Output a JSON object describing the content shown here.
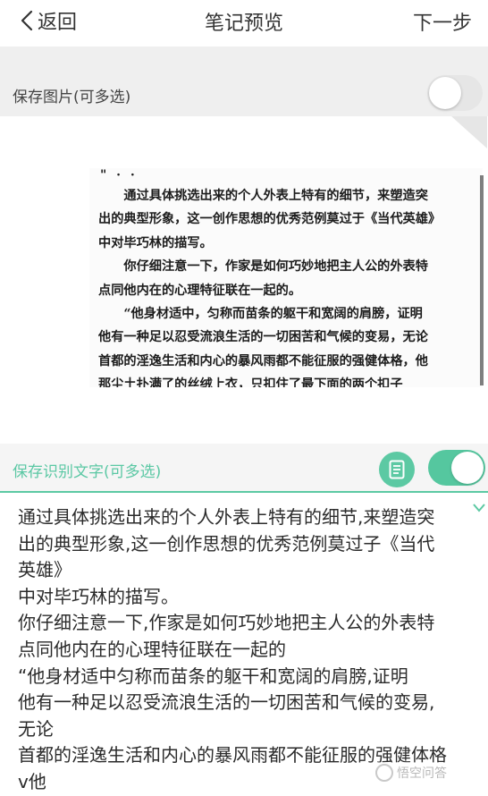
{
  "nav": {
    "back_label": "返回",
    "title": "笔记预览",
    "next_label": "下一步"
  },
  "save_image": {
    "label": "保存图片(可多选)",
    "enabled": false
  },
  "scan": {
    "top_marks": "\" · ·",
    "lines": [
      "　　通过具体挑选出来的个人外表上特有的细节，来塑造突",
      "出的典型形象，这一创作思想的优秀范例莫过于《当代英雄》",
      "中对毕巧林的描写。",
      "　　你仔细注意一下，作家是如何巧妙地把主人公的外表特",
      "点同他内在的心理特征联在一起的。",
      "　　“他身材适中，匀称而苗条的躯干和宽阔的肩膀，证明",
      "他有一种足以忍受流浪生活的一切困苦和气候的变易，无论",
      "首都的淫逸生活和内心的暴风雨都不能征服的强健体格，他",
      "那尘土扑满了的丝绒上衣，只扣住了最下面的两个扣子"
    ]
  },
  "save_text": {
    "label": "保存识别文字(可多选)",
    "enabled": true,
    "doc_icon": "document-icon"
  },
  "ocr": {
    "lines": [
      "通过具体挑选出来的个人外表上特有的细节,来塑造突",
      "出的典型形象,这一创作思想的优秀范例莫过子《当代",
      "英雄》",
      "中对毕巧林的描写。",
      "你仔细注意一下,作家是如何巧妙地把主人公的外表特",
      "点同他内在的心理特征联在一起的",
      "“他身材适中匀称而苗条的躯干和宽阔的肩膀,证明",
      "他有一种足以忍受流浪生活的一切困苦和气候的变易,",
      "无论",
      "首都的淫逸生活和内心的暴风雨都不能征服的强健体格",
      "v他"
    ]
  },
  "watermark": {
    "text": "悟空问答"
  },
  "colors": {
    "accent": "#5cc9a3",
    "text": "#333333",
    "section_bg": "#efefef"
  }
}
